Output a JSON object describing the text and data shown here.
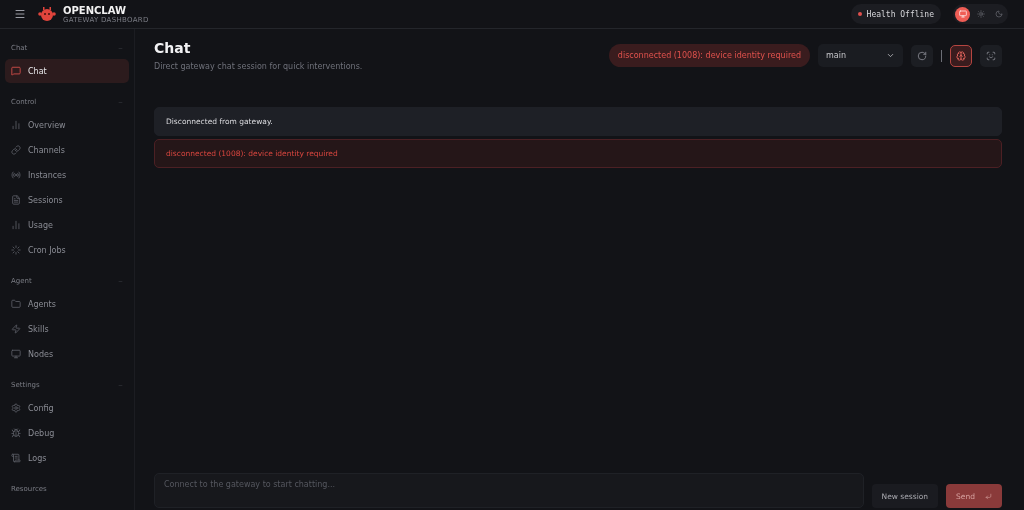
{
  "brand": {
    "title": "OPENCLAW",
    "subtitle": "GATEWAY DASHBOARD"
  },
  "health": {
    "label": "Health Offline",
    "online": false
  },
  "theme_options": [
    {
      "kind": "system",
      "selected": true
    },
    {
      "kind": "light",
      "selected": false
    },
    {
      "kind": "dark",
      "selected": false
    }
  ],
  "sidebar": {
    "sections": [
      {
        "title": "Chat",
        "expanded": true,
        "items": [
          {
            "label": "Chat",
            "kind": "chat",
            "selected": true
          }
        ]
      },
      {
        "title": "Control",
        "expanded": true,
        "items": [
          {
            "label": "Overview",
            "kind": "bars",
            "selected": false
          },
          {
            "label": "Channels",
            "kind": "link",
            "selected": false
          },
          {
            "label": "Instances",
            "kind": "radio",
            "selected": false
          },
          {
            "label": "Sessions",
            "kind": "file",
            "selected": false
          },
          {
            "label": "Usage",
            "kind": "bars",
            "selected": false
          },
          {
            "label": "Cron Jobs",
            "kind": "loader",
            "selected": false
          }
        ]
      },
      {
        "title": "Agent",
        "expanded": true,
        "items": [
          {
            "label": "Agents",
            "kind": "folder",
            "selected": false
          },
          {
            "label": "Skills",
            "kind": "zap",
            "selected": false
          },
          {
            "label": "Nodes",
            "kind": "monitor",
            "selected": false
          }
        ]
      },
      {
        "title": "Settings",
        "expanded": true,
        "items": [
          {
            "label": "Config",
            "kind": "gear",
            "selected": false
          },
          {
            "label": "Debug",
            "kind": "bug",
            "selected": false
          },
          {
            "label": "Logs",
            "kind": "scroll",
            "selected": false
          }
        ]
      },
      {
        "title": "Resources"
      }
    ]
  },
  "page": {
    "title": "Chat",
    "subtitle": "Direct gateway chat session for quick interventions."
  },
  "connection_status": "disconnected (1008): device identity required",
  "session_select": {
    "value": "main"
  },
  "messages": [
    {
      "kind": "notice",
      "text": "Disconnected from gateway."
    },
    {
      "kind": "error",
      "text": "disconnected (1008): device identity required"
    }
  ],
  "composer": {
    "placeholder": "Connect to the gateway to start chatting...",
    "new_session": "New session",
    "send": "Send",
    "send_disabled": true
  }
}
